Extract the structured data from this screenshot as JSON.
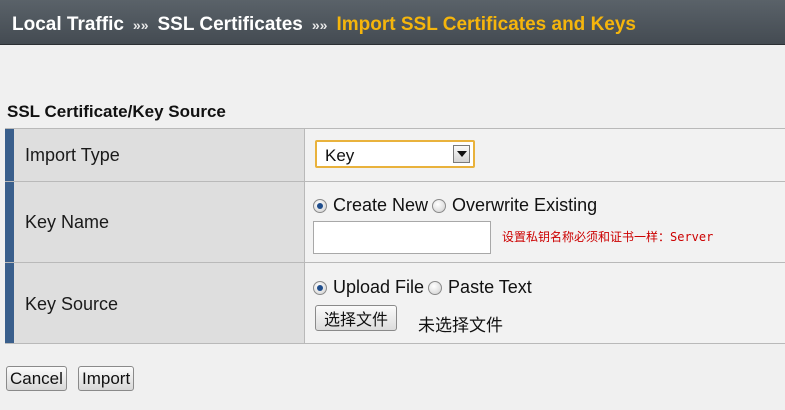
{
  "breadcrumb": {
    "items": [
      "Local Traffic",
      "SSL Certificates"
    ],
    "separator": "»»",
    "current": "Import SSL Certificates and Keys"
  },
  "section": {
    "title": "SSL Certificate/Key Source"
  },
  "import_type": {
    "label": "Import Type",
    "selected": "Key"
  },
  "key_name": {
    "label": "Key Name",
    "option_create": "Create New",
    "option_overwrite": "Overwrite Existing",
    "selected_option": "Create New",
    "value": "",
    "hint": "设置私钥名称必须和证书一样：Server"
  },
  "key_source": {
    "label": "Key Source",
    "option_upload": "Upload File",
    "option_paste": "Paste Text",
    "selected_option": "Upload File",
    "choose_button": "选择文件",
    "file_status": "未选择文件"
  },
  "actions": {
    "cancel": "Cancel",
    "import": "Import"
  },
  "colors": {
    "header_bg": "#4f575e",
    "breadcrumb_current": "#f5b50c",
    "row_accent": "#3a5f8c",
    "hint_text": "#cc0000",
    "select_focus_border": "#e9b23c"
  }
}
